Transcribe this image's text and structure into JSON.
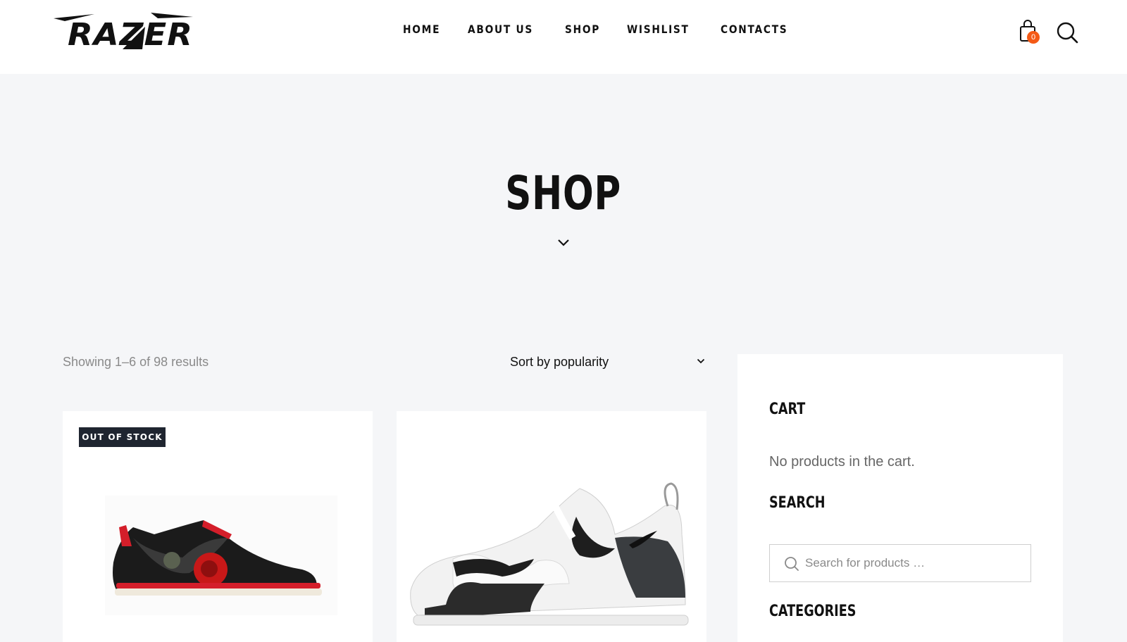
{
  "brand": {
    "logo_text": "RAZER"
  },
  "nav": {
    "items": [
      "HOME",
      "ABOUT US",
      "SHOP",
      "WISHLIST",
      "CONTACTS"
    ]
  },
  "header_icons": {
    "cart_icon": "shopping-bag-icon",
    "cart_count": "0",
    "search_icon": "search-icon"
  },
  "hero": {
    "title": "SHOP",
    "scroll_icon": "chevron-down-icon"
  },
  "toolbar": {
    "results_text": "Showing 1–6 of 98 results",
    "sort_selected": "Sort by popularity"
  },
  "products": [
    {
      "badge": "OUT OF STOCK",
      "image": "red-black-rose-sneaker"
    },
    {
      "badge": "",
      "image": "white-black-chunky-sneaker"
    }
  ],
  "sidebar": {
    "cart_title": "CART",
    "cart_empty": "No products in the cart.",
    "search_title": "SEARCH",
    "search_placeholder": "Search for products …",
    "categories_title": "CATEGORIES"
  },
  "colors": {
    "accent": "#f45a16",
    "badge_bg": "#1f2530",
    "page_bg": "#f5f6f8"
  }
}
